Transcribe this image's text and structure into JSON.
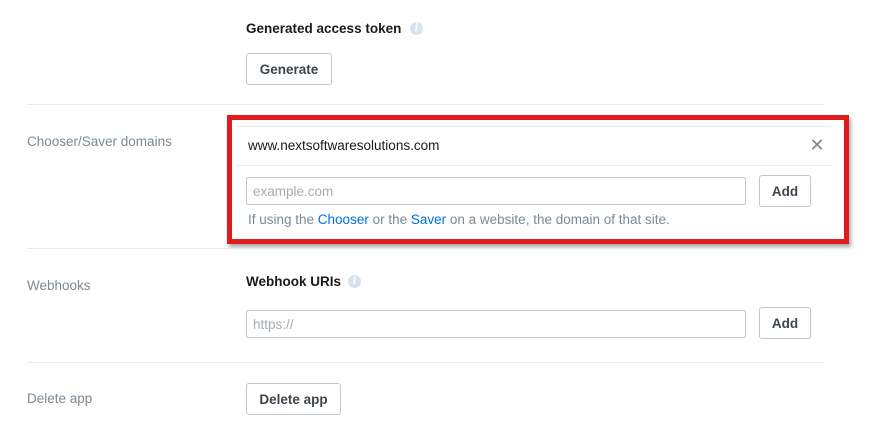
{
  "access_token": {
    "heading": "Generated access token",
    "info_icon": "info-icon",
    "generate_label": "Generate"
  },
  "chooser_saver": {
    "label": "Chooser/Saver domains",
    "domain": "www.nextsoftwaresolutions.com",
    "remove_icon": "close-icon",
    "input_placeholder": "example.com",
    "add_label": "Add",
    "help_prefix": "If using the ",
    "help_link1": "Chooser",
    "help_mid": " or the ",
    "help_link2": "Saver",
    "help_suffix": " on a website, the domain of that site.",
    "highlight_color": "#e01b1b"
  },
  "webhooks": {
    "label": "Webhooks",
    "heading": "Webhook URIs",
    "info_icon": "info-icon",
    "input_placeholder": "https://",
    "add_label": "Add"
  },
  "delete_app": {
    "label": "Delete app",
    "button_label": "Delete app"
  },
  "colors": {
    "link": "#0070e0",
    "label_gray": "#7b8994",
    "divider": "#e7e9eb"
  }
}
